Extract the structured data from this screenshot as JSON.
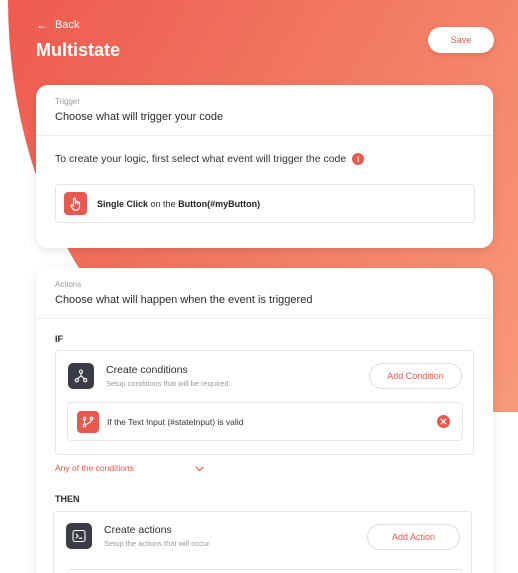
{
  "header": {
    "back_label": "Back",
    "title": "Multistate",
    "save_label": "Save"
  },
  "trigger": {
    "eyebrow": "Trigger",
    "title": "Choose what will trigger your code",
    "intro": "To create your logic, first select what event will trigger the code",
    "event": {
      "name": "Single Click",
      "connector": "on the",
      "target": "Button(#myButton)"
    }
  },
  "actions": {
    "eyebrow": "Actions",
    "title": "Choose what will happen when the event is triggered",
    "if_label": "IF",
    "conditions_block": {
      "title": "Create conditions",
      "subtitle": "Setup conditions that will be required.",
      "button_label": "Add Condition"
    },
    "condition_row": {
      "text": "If the Text Input (#stateInput) is valid"
    },
    "match_mode": "Any of the conditions",
    "then_label": "THEN",
    "actions_block": {
      "title": "Create actions",
      "subtitle": "Setup the actions that will occur.",
      "button_label": "Add Action"
    }
  },
  "colors": {
    "accent": "#e8584e",
    "dark_icon": "#3a3d43"
  }
}
